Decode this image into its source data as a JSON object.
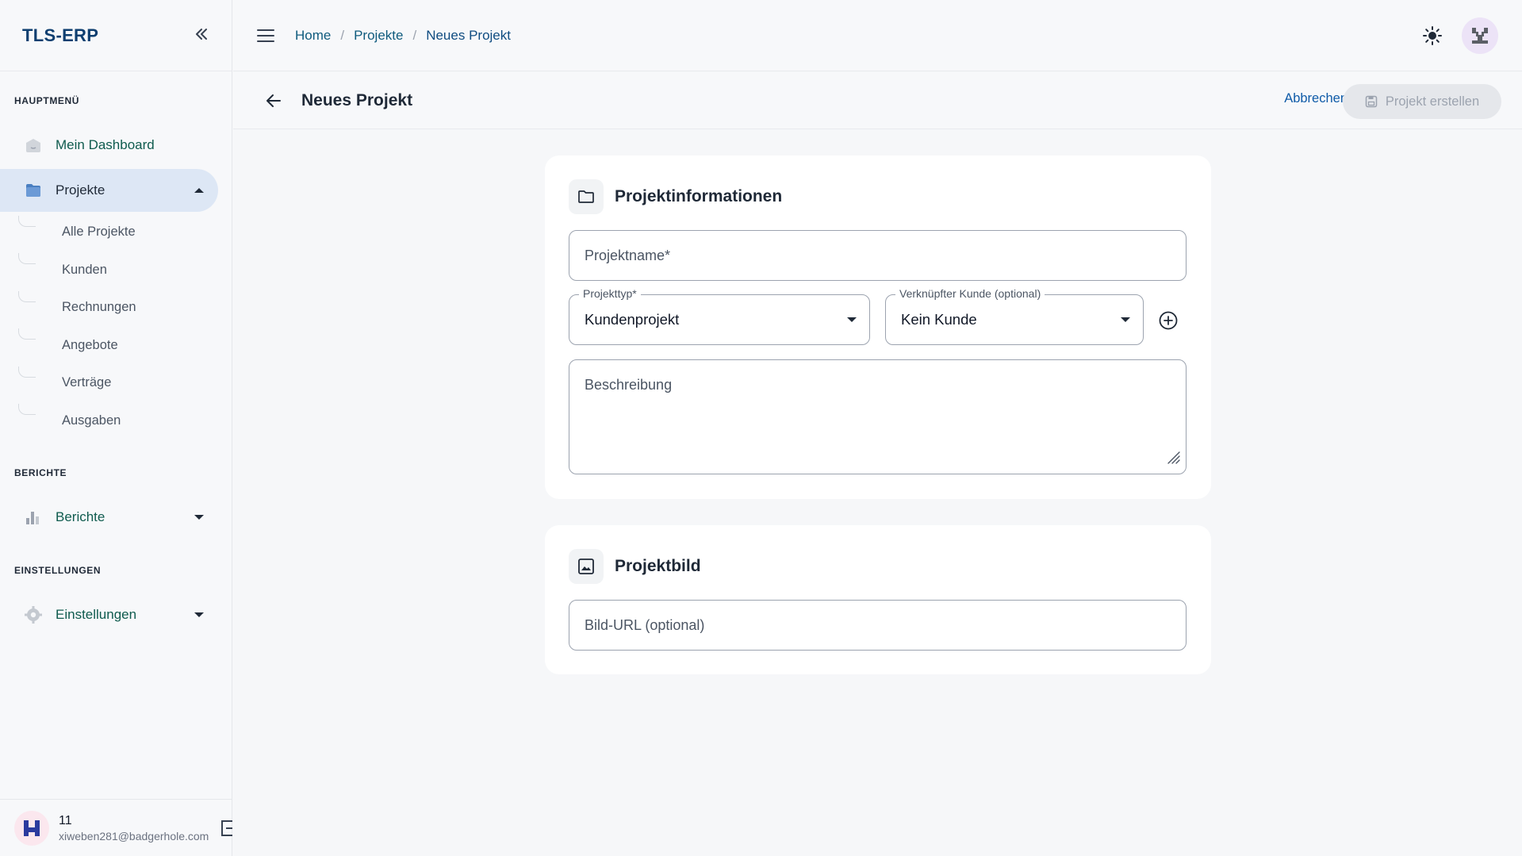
{
  "app": {
    "brand": "TLS-ERP"
  },
  "sidebar": {
    "sections": {
      "main": "HAUPTMENÜ",
      "reports": "BERICHTE",
      "settings": "EINSTELLUNGEN"
    },
    "items": {
      "dashboard": "Mein Dashboard",
      "projects": "Projekte",
      "reports": "Berichte",
      "settings": "Einstellungen"
    },
    "project_sub_items": [
      "Alle Projekte",
      "Kunden",
      "Rechnungen",
      "Angebote",
      "Verträge",
      "Ausgaben"
    ],
    "user": {
      "name": "11",
      "email": "xiweben281@badgerhole.com"
    }
  },
  "topbar": {
    "breadcrumb": [
      "Home",
      "Projekte",
      "Neues Projekt"
    ]
  },
  "header": {
    "title": "Neues Projekt",
    "cancel_label": "Abbrechen",
    "create_label": "Projekt erstellen"
  },
  "form": {
    "info_title": "Projektinformationen",
    "project_name_label": "Projektname*",
    "project_type_label": "Projekttyp*",
    "project_type_value": "Kundenprojekt",
    "customer_label": "Verknüpfter Kunde (optional)",
    "customer_value": "Kein Kunde",
    "description_label": "Beschreibung",
    "image_title": "Projektbild",
    "image_url_label": "Bild-URL (optional)"
  },
  "colors": {
    "brand": "#0f3f70",
    "link": "#0f5ba8",
    "active_nav_bg": "#dde7f5",
    "nav_text": "#0f5b4e"
  }
}
